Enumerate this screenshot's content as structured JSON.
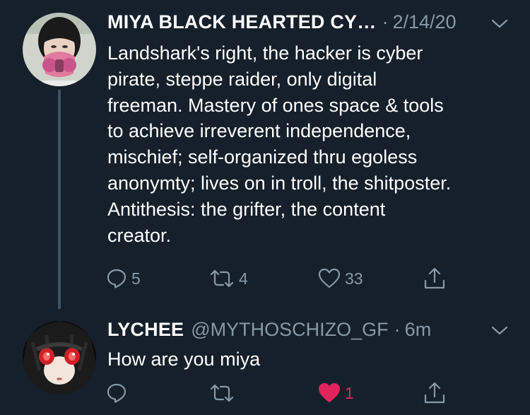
{
  "tweets": [
    {
      "display_name": "MIYA BLACK HEARTED CY…",
      "handle": "",
      "time": "2/14/20",
      "text": "Landshark's right, the hacker is cyber\npirate, steppe raider, only digital\nfreeman. Mastery of ones space & tools\nto achieve irreverent independence,\nmischief; self-organized thru egoless\nanonymty; lives on in troll, the shitposter.\nAntithesis: the grifter, the content\ncreator.",
      "replies": "5",
      "retweets": "4",
      "likes": "33",
      "liked": false
    },
    {
      "display_name": "LYCHEE",
      "handle": "@MYTHOSCHIZO_GF",
      "time": "6m",
      "text": "How are you miya",
      "replies": "",
      "retweets": "",
      "likes": "1",
      "liked": true
    }
  ],
  "separator": "·",
  "icons": {
    "reply": "reply-icon",
    "retweet": "retweet-icon",
    "like": "heart-icon",
    "share": "share-icon",
    "more": "chevron-down-icon"
  },
  "colors": {
    "background": "#15202b",
    "secondary_text": "#8899a6",
    "like_active": "#e0245e",
    "thread_line": "#3d5466"
  }
}
